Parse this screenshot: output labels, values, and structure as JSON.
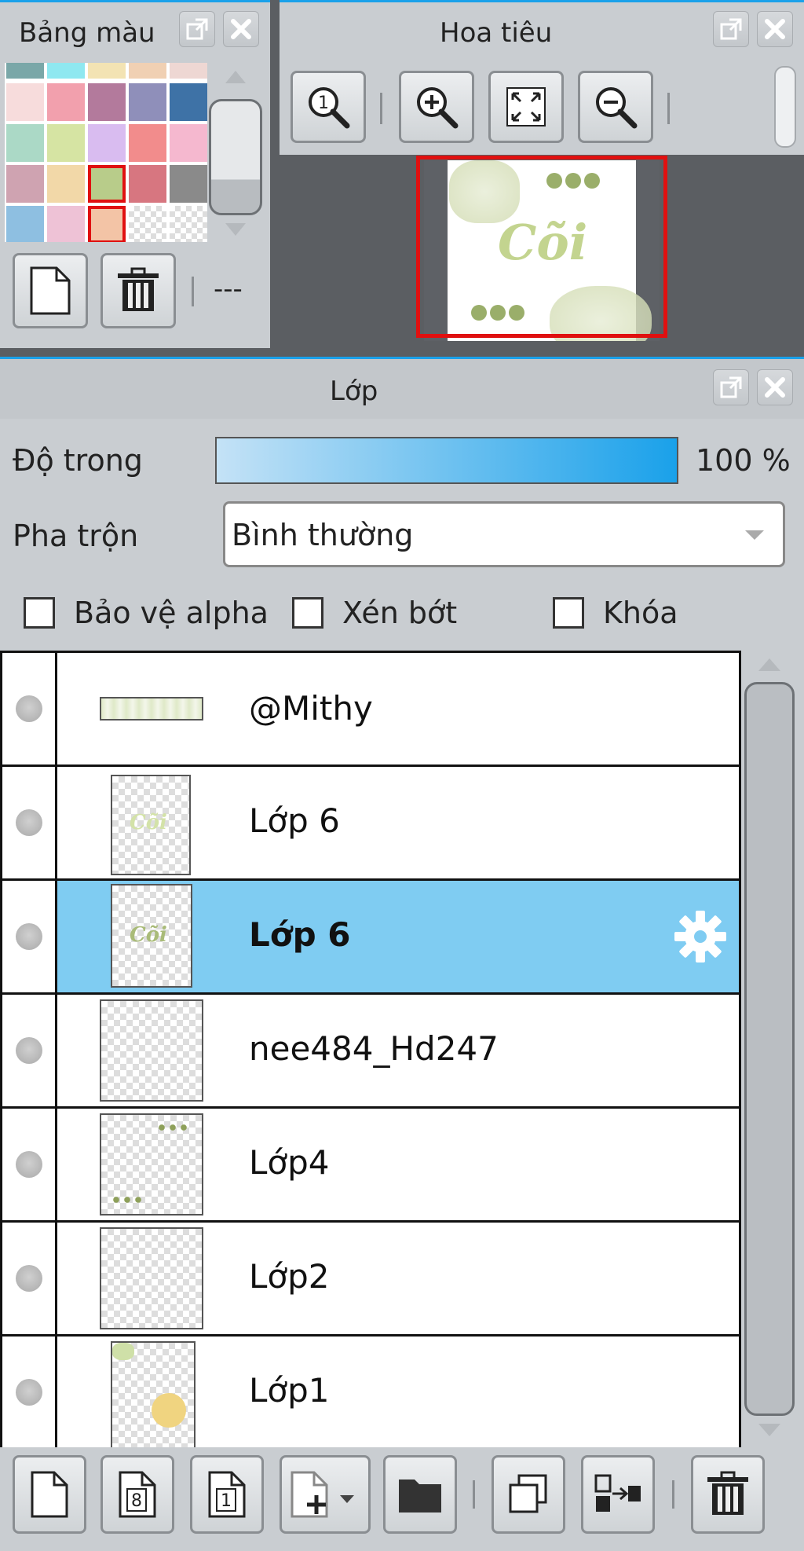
{
  "palette": {
    "title": "Bảng màu",
    "swatches": [
      [
        "#7aa7a8",
        "#8fe8f0",
        "#f3e3b3",
        "#f0d0b3",
        "#eed7d3"
      ],
      [
        "#f7dcdc",
        "#f2a0ad",
        "#b37a9c",
        "#8f8fba",
        "#3e72a6"
      ],
      [
        "#abd9c6",
        "#d6e4a3",
        "#d9bcf0",
        "#f28c8c",
        "#f5b8cf"
      ],
      [
        "#cfa3b1",
        "#f2d8a8",
        "#b8cc8a",
        "#d77680",
        "#8a8a8a"
      ],
      [
        "#8ebfe1",
        "#eec2d6",
        "#f3c4a6",
        "checker",
        "checker"
      ]
    ],
    "dash": "---"
  },
  "navigator": {
    "title": "Hoa tiêu",
    "tools": [
      "zoom-100-icon",
      "zoom-in-icon",
      "fit-screen-icon",
      "zoom-out-icon"
    ],
    "preview_text": "Cõi"
  },
  "layers_panel": {
    "title": "Lớp",
    "opacity_label": "Độ trong",
    "opacity_value": "100 %",
    "opacity_fraction": 1.0,
    "blend_label": "Pha trộn",
    "blend_value": "Bình thường",
    "protect_alpha": "Bảo vệ alpha",
    "clipping": "Xén bớt",
    "lock": "Khóa",
    "layers": [
      {
        "name": "@Mithy",
        "selected": false
      },
      {
        "name": "Lớp 6",
        "selected": false
      },
      {
        "name": "Lớp 6",
        "selected": true
      },
      {
        "name": "nee484_Hd247",
        "selected": false
      },
      {
        "name": "Lớp4",
        "selected": false
      },
      {
        "name": "Lớp2",
        "selected": false
      },
      {
        "name": "Lớp1",
        "selected": false
      }
    ],
    "bottom_tools": [
      "new-layer-icon",
      "new-8bit-layer-icon",
      "new-1bit-layer-icon",
      "add-layer-menu-icon",
      "new-folder-icon",
      "duplicate-layer-icon",
      "merge-down-icon",
      "delete-layer-icon"
    ]
  },
  "colors": {
    "accent": "#1aa1ea",
    "selected_row": "#7fccf2",
    "nav_frame": "#e01010"
  }
}
